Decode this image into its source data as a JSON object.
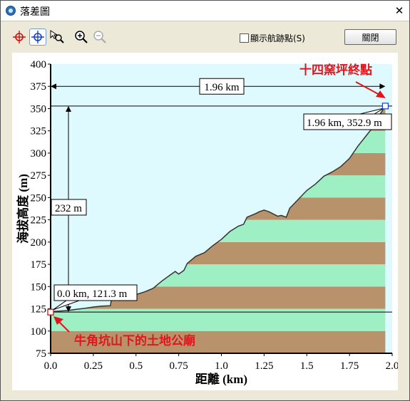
{
  "window": {
    "title": "落差圖",
    "close_glyph": "✕"
  },
  "toolbar": {
    "tools": [
      {
        "name": "crosshair-red-icon",
        "active": false
      },
      {
        "name": "crosshair-blue-icon",
        "active": true
      },
      {
        "name": "zoom-cursor-icon",
        "active": false
      },
      {
        "name": "zoom-in-icon",
        "active": false
      },
      {
        "name": "zoom-out-icon",
        "active": false
      }
    ],
    "show_points_label": "顯示航跡點(S)",
    "show_points_checked": false,
    "close_label": "關閉"
  },
  "chart_data": {
    "type": "area",
    "xlabel": "距離 (km)",
    "ylabel": "海拔高度 (m)",
    "xlim": [
      0,
      2.0
    ],
    "ylim": [
      75,
      400
    ],
    "xticks": [
      "0.0",
      "0.25",
      "0.5",
      "0.75",
      "1.0",
      "1.25",
      "1.5",
      "1.75",
      "2.0"
    ],
    "yticks": [
      "75",
      "100",
      "125",
      "150",
      "175",
      "200",
      "225",
      "250",
      "275",
      "300",
      "325",
      "350",
      "375",
      "400"
    ],
    "x": [
      0,
      0.02,
      0.05,
      0.1,
      0.15,
      0.2,
      0.25,
      0.3,
      0.35,
      0.36,
      0.4,
      0.45,
      0.5,
      0.55,
      0.6,
      0.65,
      0.7,
      0.73,
      0.75,
      0.78,
      0.8,
      0.85,
      0.9,
      0.95,
      1.0,
      1.05,
      1.1,
      1.13,
      1.15,
      1.2,
      1.22,
      1.25,
      1.28,
      1.3,
      1.33,
      1.35,
      1.38,
      1.4,
      1.45,
      1.5,
      1.55,
      1.6,
      1.62,
      1.65,
      1.7,
      1.75,
      1.8,
      1.85,
      1.9,
      1.93,
      1.96
    ],
    "y": [
      121.3,
      122,
      122.5,
      123,
      124.5,
      125.5,
      127,
      128,
      128.5,
      140,
      140.5,
      141,
      141,
      144,
      148,
      156,
      163,
      167,
      164,
      168,
      176,
      184,
      188,
      196,
      203,
      212,
      218,
      220,
      228,
      232,
      234,
      236,
      234,
      232,
      229,
      230,
      228,
      238,
      248,
      258,
      265,
      274,
      276,
      279,
      285,
      294,
      308,
      320,
      332,
      344,
      352.9
    ],
    "bands": {
      "step": 25,
      "color_a": "#b8926a",
      "color_b": "#9ef0c4"
    },
    "sky_color": "#dffaff",
    "start_label": "0.0 km, 121.3 m",
    "end_label": "1.96 km, 352.9 m",
    "distance_label": "1.96 km",
    "climb_label": "232 m",
    "annotations": {
      "start": "牛角坑山下的土地公廟",
      "end": "十四窯坪終點",
      "color": "#e0161c"
    }
  }
}
